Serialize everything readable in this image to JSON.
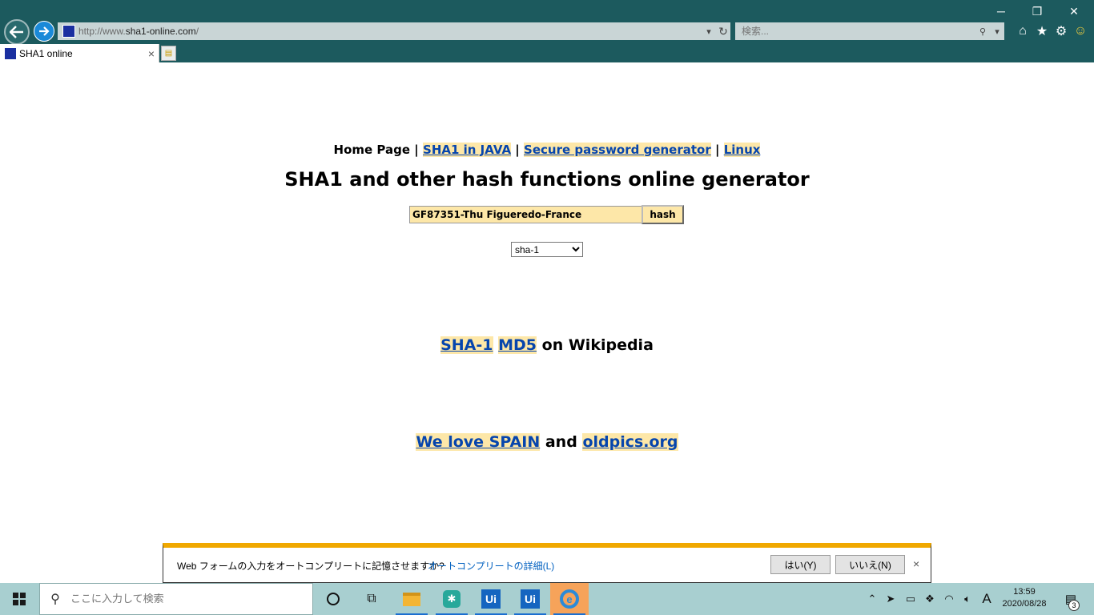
{
  "browser": {
    "url_prefix": "http://www.",
    "url_domain": "sha1-online.com",
    "url_suffix": "/",
    "search_placeholder": "検索...",
    "tab_title": "SHA1 online",
    "tab_close": "×",
    "window_controls": [
      "─",
      "❐",
      "✕"
    ]
  },
  "page": {
    "nav": {
      "home": "Home Page",
      "sep": "|",
      "sha1_java": "SHA1 in JAVA",
      "password_generator": "Secure password generator",
      "linux": "Linux"
    },
    "title": "SHA1 and other hash functions online generator",
    "hash_input_value": "GF87351-Thu Figueredo-France",
    "hash_button": "hash",
    "algorithm_selected": "sha-1",
    "wiki": {
      "sha1": "SHA-1",
      "md5": "MD5",
      "suffix": "on Wikipedia"
    },
    "spain": {
      "we_love": "We love SPAIN",
      "and": "and",
      "oldpics": "oldpics.org"
    }
  },
  "autocomplete_bar": {
    "message": "Web フォームの入力をオートコンプリートに記憶させますか?",
    "details_link": "オートコンプリートの詳細(L)",
    "yes": "はい(Y)",
    "no": "いいえ(N)",
    "close": "×"
  },
  "taskbar": {
    "search_placeholder": "ここに入力して検索",
    "ui_label": "Ui",
    "clock_time": "13:59",
    "clock_date": "2020/08/28",
    "notification_count": "3",
    "ime": "A"
  },
  "colors": {
    "chrome_bg": "#1c5a5e",
    "link_highlight": "#fde7a8",
    "link": "#0645ad",
    "notif_accent": "#f0a800",
    "taskbar_bg": "#a8cfd0"
  }
}
